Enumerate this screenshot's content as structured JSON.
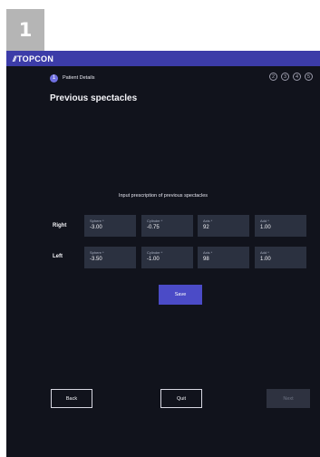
{
  "step_badge": "1",
  "brand": {
    "logo_mark": "//",
    "logo_text": "TOPCON"
  },
  "progress": {
    "active_step": "1",
    "active_label": "Patient Details",
    "future_steps": [
      "2",
      "3",
      "4",
      "5"
    ]
  },
  "page": {
    "title": "Previous spectacles",
    "instruction": "Input prescription of previous spectacles"
  },
  "prescription": {
    "right": {
      "label": "Right",
      "sphere": {
        "label": "Sphere *",
        "value": "-3.00"
      },
      "cylinder": {
        "label": "Cylinder *",
        "value": "-0.75"
      },
      "axis": {
        "label": "Axis *",
        "value": "92"
      },
      "add": {
        "label": "Add *",
        "value": "1.00"
      }
    },
    "left": {
      "label": "Left",
      "sphere": {
        "label": "Sphere *",
        "value": "-3.50"
      },
      "cylinder": {
        "label": "Cylinder *",
        "value": "-1.00"
      },
      "axis": {
        "label": "Axis *",
        "value": "98"
      },
      "add": {
        "label": "Add *",
        "value": "1.00"
      }
    }
  },
  "buttons": {
    "save": "Save",
    "back": "Back",
    "quit": "Quit",
    "next": "Next"
  }
}
